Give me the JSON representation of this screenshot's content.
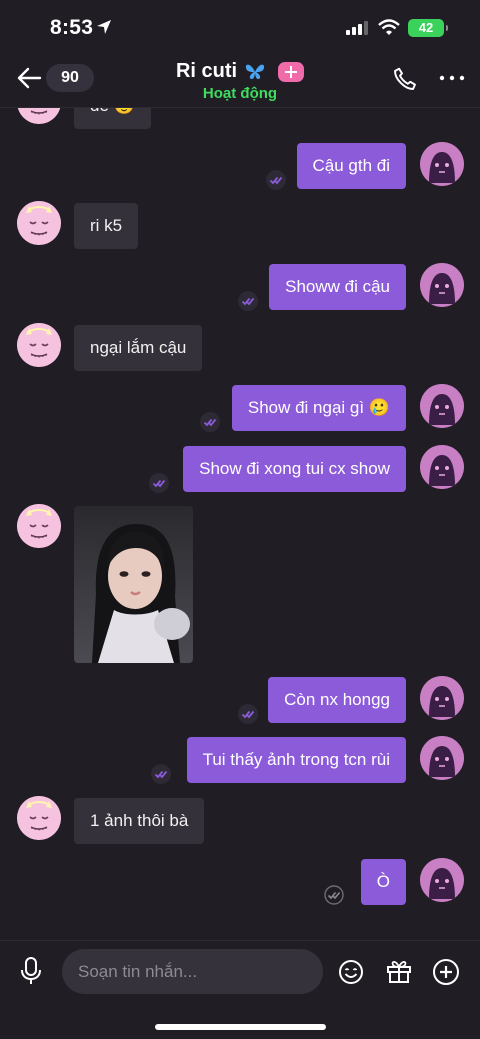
{
  "status_bar": {
    "time": "8:53",
    "battery": "42"
  },
  "header": {
    "unread_count": "90",
    "contact_name": "Ri cuti",
    "contact_status": "Hoạt động"
  },
  "messages": [
    {
      "side": "in",
      "text": "dễ 🥹",
      "partial": true
    },
    {
      "side": "out",
      "text": "Cậu gth đi"
    },
    {
      "side": "in",
      "text": "ri k5"
    },
    {
      "side": "out",
      "text": "Showw đi cậu"
    },
    {
      "side": "in",
      "text": "ngại lắm cậu"
    },
    {
      "side": "out",
      "text": "Show đi ngại gì 🥲"
    },
    {
      "side": "out",
      "text": "Show đi xong tui cx show"
    },
    {
      "side": "in",
      "type": "image"
    },
    {
      "side": "out",
      "text": "Còn nx hongg"
    },
    {
      "side": "out",
      "text": "Tui thấy ảnh trong tcn rùi"
    },
    {
      "side": "in",
      "text": "1 ảnh thôi bà"
    },
    {
      "side": "out",
      "text": "Ò"
    }
  ],
  "composer": {
    "placeholder": "Soạn tin nhắn..."
  },
  "colors": {
    "background": "#201d25",
    "outgoing_bubble": "#8c5bd9",
    "incoming_bubble": "#35313b",
    "online": "#3fdc5e",
    "accent_pink": "#f06ba9"
  }
}
